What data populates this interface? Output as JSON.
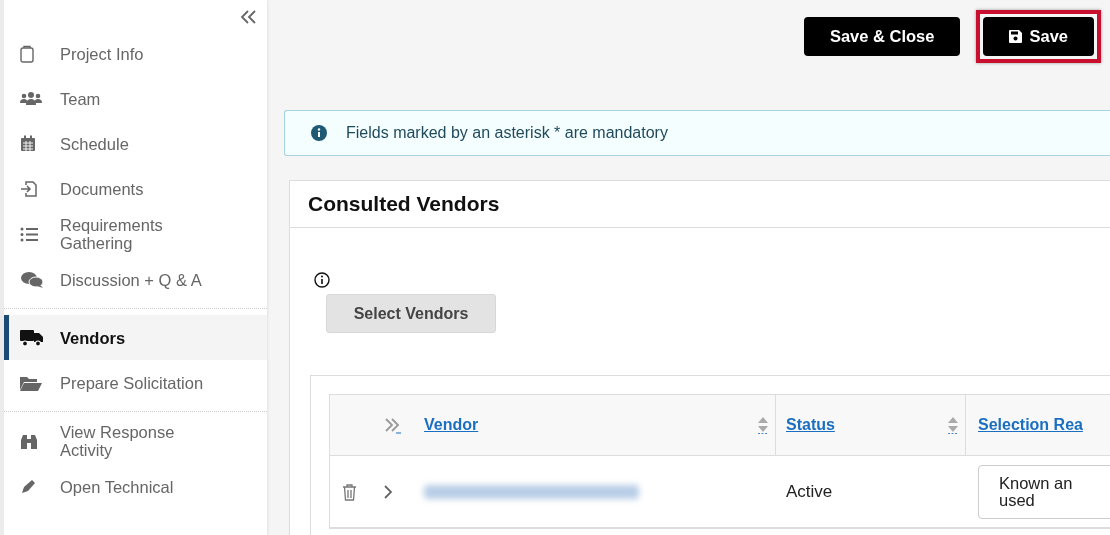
{
  "sidebar": {
    "items": [
      {
        "label": "Project Info",
        "selected": false,
        "divider_after": false
      },
      {
        "label": "Team",
        "selected": false,
        "divider_after": false
      },
      {
        "label": "Schedule",
        "selected": false,
        "divider_after": false
      },
      {
        "label": "Documents",
        "selected": false,
        "divider_after": false
      },
      {
        "label": "Requirements Gathering",
        "selected": false,
        "divider_after": false
      },
      {
        "label": "Discussion + Q & A",
        "selected": false,
        "divider_after": true
      },
      {
        "label": "Vendors",
        "selected": true,
        "divider_after": false
      },
      {
        "label": "Prepare Solicitation",
        "selected": false,
        "divider_after": true
      },
      {
        "label": "View Response Activity",
        "selected": false,
        "divider_after": false
      },
      {
        "label": "Open Technical",
        "selected": false,
        "divider_after": false
      }
    ]
  },
  "toolbar": {
    "buttons": [
      {
        "label": "Save & Close",
        "highlighted": false
      },
      {
        "label": "Save",
        "highlighted": true
      }
    ]
  },
  "notice": "Fields marked by an asterisk * are mandatory",
  "section": {
    "title": "Consulted Vendors",
    "select_button": "Select Vendors",
    "table": {
      "columns": [
        "Vendor",
        "Status",
        "Selection Rea"
      ],
      "rows": [
        {
          "status": "Active",
          "selection_reason": "Known an used"
        }
      ]
    }
  }
}
